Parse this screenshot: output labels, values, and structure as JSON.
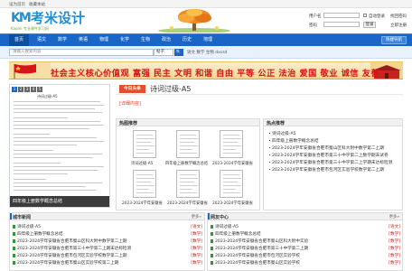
{
  "topbar": {
    "set_home": "设为首页",
    "bookmark": "收藏本站"
  },
  "brand": {
    "mark": "KM",
    "name": "考米设计",
    "slogan": "Kaomi 专业课件学习网"
  },
  "login": {
    "username_label": "用户名",
    "password_label": "密码",
    "remember_label": "自动登录",
    "forgot_link": "找回密码",
    "register_link": "立即注册",
    "login_button": "登录"
  },
  "nav": {
    "items": [
      "首页",
      "语文",
      "数学",
      "英语",
      "物理",
      "化学",
      "生物",
      "政治",
      "历史",
      "地理"
    ],
    "quick_button": "快捷导航"
  },
  "search": {
    "placeholder": "请输入搜索内容",
    "type": "帖子",
    "button": "🔍",
    "hot_words": "语文 数学 生物 dxcsd"
  },
  "banner": {
    "text": "社会主义核心价值观  富强 民主 文明 和谐 自由 平等 公正 法治 爱国 敬业 诚信 友善"
  },
  "doc_preview": {
    "pages": [
      "1",
      "2",
      "3",
      "4",
      "5"
    ],
    "page_heading": "诗词过级-A5",
    "caption": "四年级上册数学概念总结"
  },
  "main": {
    "tag": "今日头条",
    "title": "诗词过级-A5",
    "detail_link": "[详细内容]"
  },
  "hot_recommend": {
    "heading": "热图推荐",
    "thumbs": [
      {
        "caption": "诗词过级-A5"
      },
      {
        "caption": "四年级上册数学概念总结"
      },
      {
        "caption": "2023-2024学年安徽省"
      },
      {
        "caption": "2023-2024学年安徽省"
      },
      {
        "caption": "2023-2024学年安徽省"
      },
      {
        "caption": "2023-2024学年安徽省"
      }
    ]
  },
  "hot_points": {
    "heading": "热点推荐",
    "items": [
      "诗词过级-A5",
      "四年级上册数学概念总结",
      "2023-2024学年安徽省合肥市蜀山区科大附中数学第二上期",
      "2023-2024学年安徽省合肥市第三十中学第二上数学期末试卷",
      "2023-2024学年安徽省合肥市第三十中学第二上学期末达标检测",
      "2023-2024学年安徽省合肥市包河区实验学校数学第二上期"
    ]
  },
  "latest": {
    "heading": "城市新闻",
    "more": "更多»",
    "rows": [
      {
        "text": "诗词过级-A5",
        "tag": "[语文]"
      },
      {
        "text": "四年级上册数学概念总结",
        "tag": "[数学]"
      },
      {
        "text": "2023-2024学年安徽省合肥市蜀山区科大附中数学第二上期",
        "tag": "[数学]"
      },
      {
        "text": "2023-2024学年安徽省合肥市第三十中学第二上期末达标检测",
        "tag": "[数学]"
      },
      {
        "text": "2023-2024学年安徽省合肥市包河区实验学校数学第二上期",
        "tag": "[数学]"
      },
      {
        "text": "2023-2024学年安徽省合肥市蜀山区实验学校第二上期",
        "tag": "[数学]"
      }
    ]
  },
  "community": {
    "heading": "网友中心",
    "more": "更多»",
    "rows": [
      {
        "text": "诗词过级-A5",
        "tag": "[语文]"
      },
      {
        "text": "四年级上册数学概念总结",
        "tag": "[数学]"
      },
      {
        "text": "2023-2024学年安徽省合肥市蜀山区科大附中实验",
        "tag": "[数学]"
      },
      {
        "text": "2023-2024学年安徽省合肥市第三十中学第二上期",
        "tag": "[数学]"
      },
      {
        "text": "2023-2024学年安徽省合肥市包河区实验学校",
        "tag": "[数学]"
      },
      {
        "text": "2023-2024学年安徽省合肥市蜀山区实验学校",
        "tag": "[数学]"
      }
    ]
  },
  "colors": {
    "nav": "#1a66c8",
    "nav_active": "#0c4f9e",
    "banner_text": "#d8131a",
    "tag": "#e14f2c"
  }
}
